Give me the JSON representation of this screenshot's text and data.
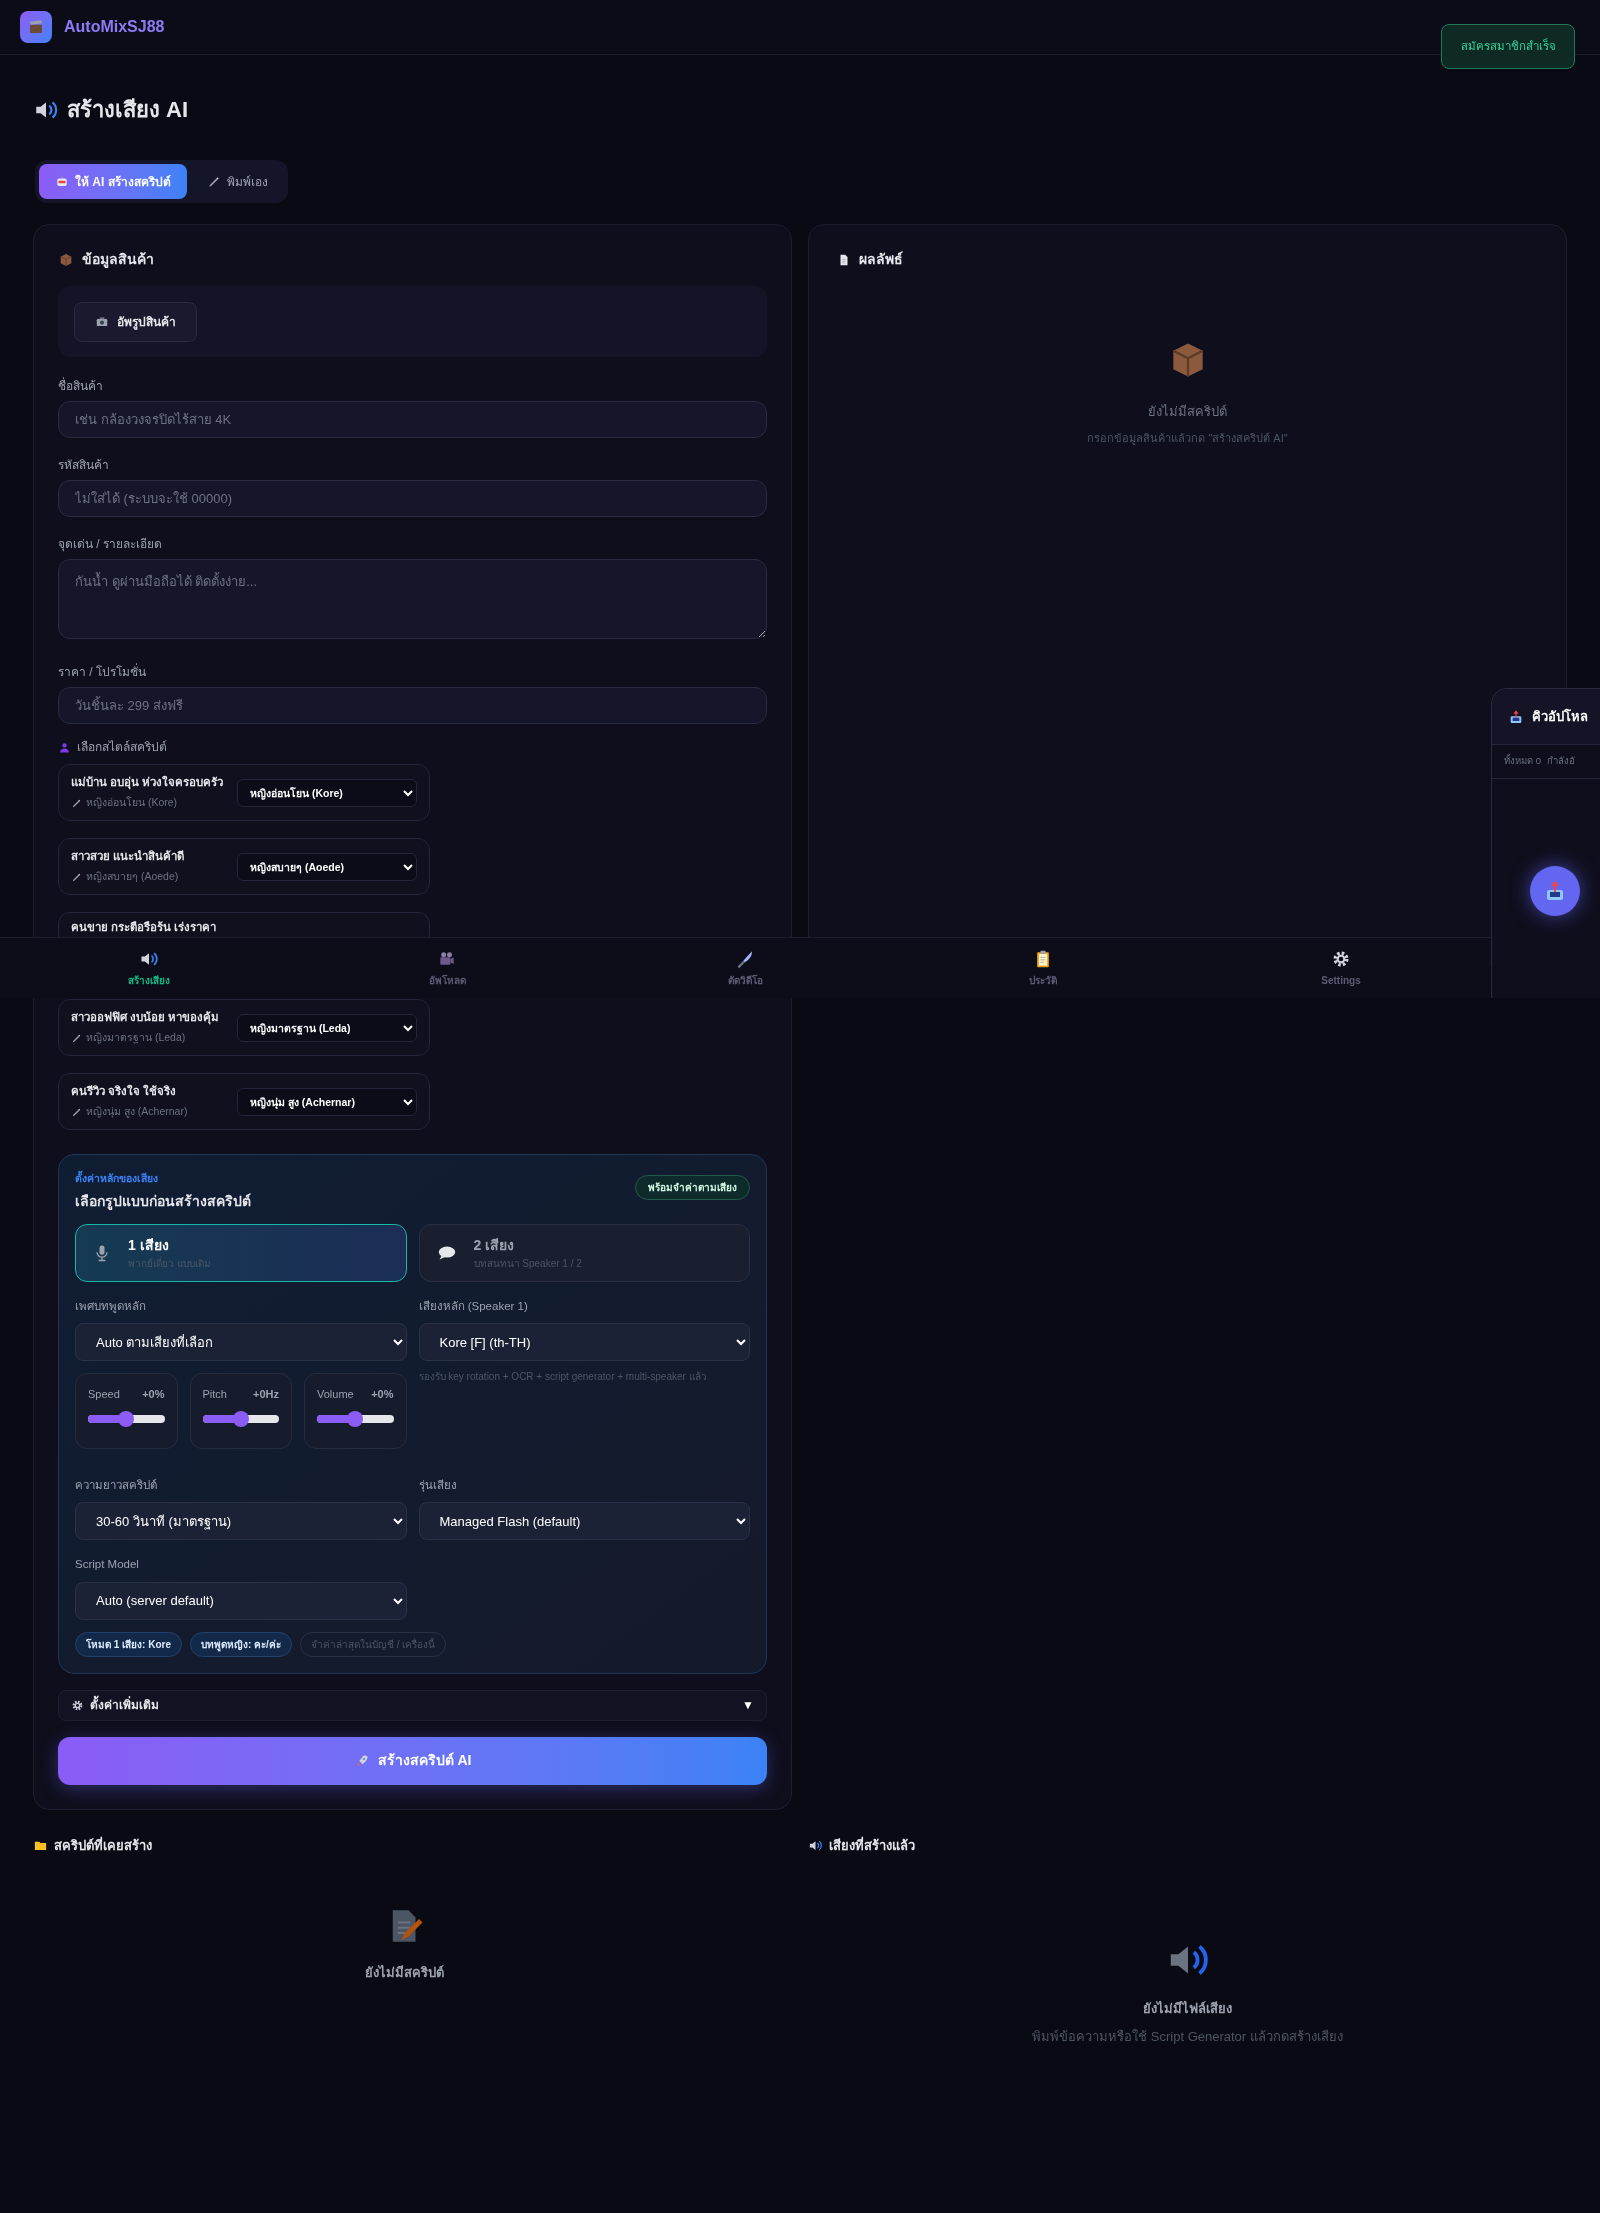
{
  "app": {
    "name": "AutoMixSJ88"
  },
  "toast": {
    "text": "สมัครสมาชิกสำเร็จ"
  },
  "page_title": "สร้างเสียง AI",
  "mode_tabs": [
    {
      "label": "ให้ AI สร้างสคริปต์",
      "selected": true
    },
    {
      "label": "พิมพ์เอง",
      "selected": false
    }
  ],
  "product_card": {
    "title": "ข้อมูลสินค้า",
    "upload_button": "อัพรูปสินค้า",
    "fields": [
      {
        "kind": "input",
        "label": "ชื่อสินค้า",
        "placeholder": "เช่น กล้องวงจรปิดไร้สาย 4K"
      },
      {
        "kind": "input",
        "label": "รหัสสินค้า",
        "placeholder": "ไม่ใส่ได้ (ระบบจะใช้ 00000)"
      },
      {
        "kind": "textarea",
        "label": "จุดเด่น / รายละเอียด",
        "placeholder": "กันน้ำ ดูผ่านมือถือได้ ติดตั้งง่าย..."
      },
      {
        "kind": "input",
        "label": "ราคา / โปรโมชั่น",
        "placeholder": "วันชิ้นละ 299 ส่งฟรี"
      }
    ],
    "style_heading": "เลือกสไตล์สคริปต์",
    "styles": [
      {
        "name": "แม่บ้าน อบอุ่น ห่วงใจครอบครัว",
        "voice": "หญิงอ่อนโยน (Kore)",
        "select": "หญิงอ่อนโยน (Kore)"
      },
      {
        "name": "สาวสวย แนะนำสินค้าดี",
        "voice": "หญิงสบายๆ (Aoede)",
        "select": "หญิงสบายๆ (Aoede)"
      },
      {
        "name": "คนขาย กระตือรือร้น เร่งราคา"
      },
      {
        "name": "สาวออฟฟิศ งบน้อย หาของคุ้ม",
        "voice": "หญิงมาตรฐาน (Leda)",
        "select": "หญิงมาตรฐาน (Leda)"
      },
      {
        "name": "คนรีวิว จริงใจ ใช้จริง",
        "voice": "หญิงนุ่ม สูง (Achernar)",
        "select": "หญิงนุ่ม สูง (Achernar)"
      }
    ]
  },
  "voice_settings": {
    "eyebrow": "ตั้งค่าหลักของเสียง",
    "title": "เลือกรูปแบบก่อนสร้างสคริปต์",
    "badge": "พร้อมจำค่าตามเสียง",
    "modes": [
      {
        "title": "1 เสียง",
        "subtitle": "พากย์เดี่ยว แบบเดิม",
        "selected": true
      },
      {
        "title": "2 เสียง",
        "subtitle": "บทสนทนา Speaker 1 / 2",
        "selected": false
      }
    ],
    "gender": {
      "label": "เพศบทพูดหลัก",
      "value": "Auto ตามเสียงที่เลือก"
    },
    "speaker": {
      "label": "เสียงหลัก (Speaker 1)",
      "value": "Kore [F] (th-TH)",
      "hint": "รองรับ key rotation + OCR + script generator + multi-speaker แล้ว"
    },
    "sliders": [
      {
        "label": "Speed",
        "reading": "+0%",
        "level": 0.5
      },
      {
        "label": "Pitch",
        "reading": "+0Hz",
        "level": 0.5
      },
      {
        "label": "Volume",
        "reading": "+0%",
        "level": 0.5
      }
    ],
    "length": {
      "label": "ความยาวสคริปต์",
      "value": "30-60 วินาที (มาตรฐาน)"
    },
    "voice_model": {
      "label": "รุ่นเสียง",
      "value": "Managed Flash (default)"
    },
    "script_model": {
      "label": "Script Model",
      "value": "Auto (server default)"
    },
    "chips": [
      {
        "kind": "tag",
        "text": "โหมด 1 เสียง: Kore"
      },
      {
        "kind": "tag",
        "text": "บทพูดหญิง: คะ/ค่ะ"
      },
      {
        "kind": "hint",
        "text": "จำค่าล่าสุดในบัญชี / เครื่องนี้"
      }
    ]
  },
  "advanced": {
    "label": "ตั้งค่าเพิ่มเติม",
    "arrow": "▼"
  },
  "generate_button": "สร้างสคริปต์ AI",
  "result_card": {
    "title": "ผลลัพธ์",
    "empty_title": "ยังไม่มีสคริปต์",
    "empty_hint": "กรอกข้อมูลสินค้าแล้วกด \"สร้างสคริปต์ AI\""
  },
  "history": {
    "title": "สคริปต์ที่เคยสร้าง",
    "empty_title": "ยังไม่มีสคริปต์"
  },
  "audio": {
    "title": "เสียงที่สร้างแล้ว",
    "empty_title": "ยังไม่มีไฟล์เสียง",
    "empty_hint": "พิมพ์ข้อความหรือใช้ Script Generator แล้วกดสร้างเสียง"
  },
  "bottom_nav": [
    {
      "label": "สร้างเสียง",
      "selected": true
    },
    {
      "label": "อัพโหลด",
      "selected": false
    },
    {
      "label": "ตัดวิดีโอ",
      "selected": false
    },
    {
      "label": "ประวัติ",
      "selected": false
    },
    {
      "label": "Settings",
      "selected": false
    }
  ],
  "upload_queue": {
    "title": "คิวอัปโหล",
    "stats": [
      "ทั้งหมด 0",
      "กำลังอั"
    ]
  }
}
